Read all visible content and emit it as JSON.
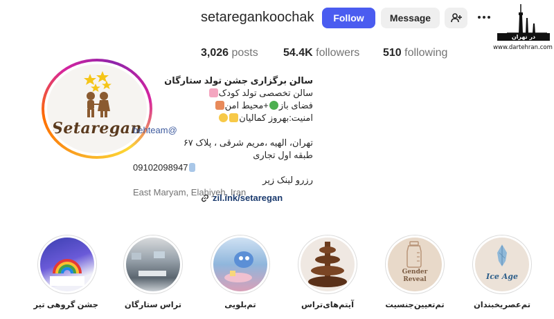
{
  "profile": {
    "username": "setaregankoochak",
    "avatar_text": "Setaregan",
    "follow_label": "Follow",
    "message_label": "Message"
  },
  "watermark": {
    "band_text": "در تهران",
    "url": "www.dartehran.com"
  },
  "stats": {
    "posts_count": "3,026",
    "posts_label": "posts",
    "followers_count": "54.4K",
    "followers_label": "followers",
    "following_count": "510",
    "following_label": "following"
  },
  "bio": {
    "name": "سالن برگزاری جشن تولد ستارگان",
    "line1": "سالن تخصصی تولد کودک",
    "line2": "فضای باز",
    "line2b": "+محیط امن",
    "line3": "امنیت:بهروز کمالیان",
    "tag": "behteam@",
    "address1": "تهران، الهیه ،مریم شرقی ، پلاک ۶۷",
    "address2": "طبقه اول تجاری",
    "phone": "09102098947",
    "cta": "رزرو لینک زیر",
    "location": "East Maryam, Elahiyeh, Iran",
    "link": "zil.ink/setaregan"
  },
  "highlights": [
    {
      "label": "جشن گروهی تیر"
    },
    {
      "label": "تراس ستارگان"
    },
    {
      "label": "تم‌بلویی"
    },
    {
      "label": "آیتم‌های‌تراس"
    },
    {
      "label": "تم‌تعیین‌جنسیت",
      "image_text_1": "Gender",
      "image_text_2": "Reveal"
    },
    {
      "label": "تم‌عصریخبندان",
      "image_text": "Ice Age"
    }
  ],
  "icons": {
    "add_user": "add-user-icon",
    "more": "more-icon",
    "link": "link-icon"
  }
}
